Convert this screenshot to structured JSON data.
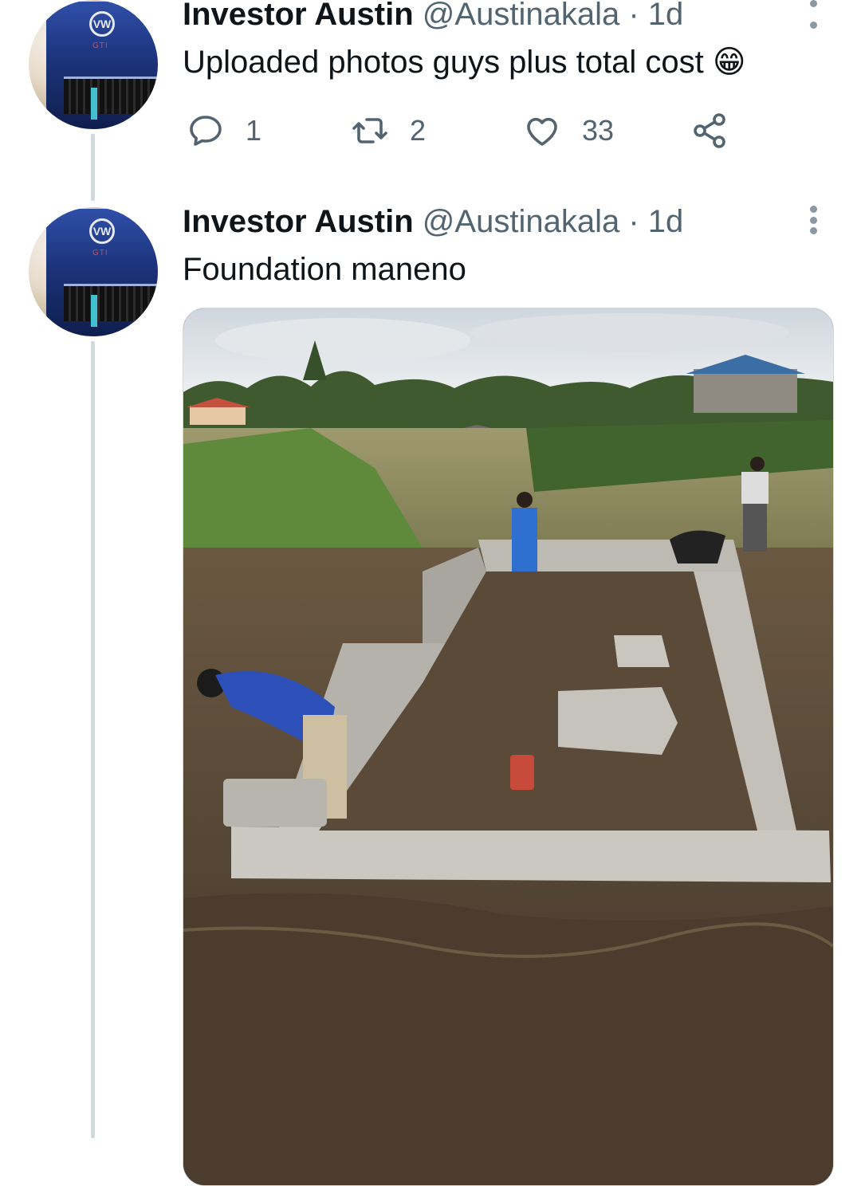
{
  "tweets": [
    {
      "author_name": "Investor Austin",
      "handle": "@Austinakala",
      "separator": "·",
      "time": "1d",
      "text": "Uploaded photos guys plus total cost",
      "emoji": "😁",
      "actions": {
        "replies": "1",
        "retweets": "2",
        "likes": "33"
      }
    },
    {
      "author_name": "Investor Austin",
      "handle": "@Austinakala",
      "separator": "·",
      "time": "1d",
      "text": "Foundation maneno"
    }
  ],
  "avatar": {
    "logo": "VW",
    "badge": "GTI"
  },
  "icons": {
    "reply": "speech-bubble-icon",
    "retweet": "retweet-icon",
    "like": "heart-icon",
    "share": "share-icon",
    "more": "more-vertical-icon"
  },
  "colors": {
    "text_primary": "#0f1419",
    "text_secondary": "#536471",
    "thread_line": "#cfd9de",
    "more_dots": "#8b98a5"
  }
}
